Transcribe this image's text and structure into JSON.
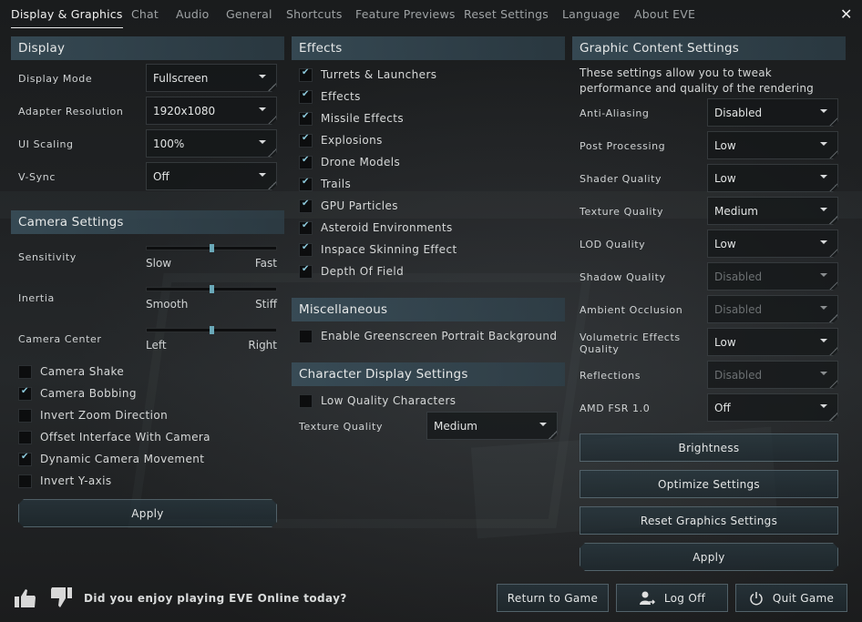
{
  "tabs": [
    {
      "label": "Display & Graphics",
      "active": true
    },
    {
      "label": "Chat"
    },
    {
      "label": "Audio"
    },
    {
      "label": "General"
    },
    {
      "label": "Shortcuts"
    },
    {
      "label": "Feature Previews"
    },
    {
      "label": "Reset Settings"
    },
    {
      "label": "Language"
    },
    {
      "label": "About EVE"
    }
  ],
  "close_icon": "✕",
  "display": {
    "title": "Display",
    "rows": [
      {
        "label": "Display Mode",
        "value": "Fullscreen"
      },
      {
        "label": "Adapter Resolution",
        "value": "1920x1080"
      },
      {
        "label": "UI Scaling",
        "value": "100%"
      },
      {
        "label": "V-Sync",
        "value": "Off"
      }
    ]
  },
  "camera": {
    "title": "Camera Settings",
    "sliders": [
      {
        "label": "Sensitivity",
        "min_label": "Slow",
        "max_label": "Fast",
        "value_pct": 50
      },
      {
        "label": "Inertia",
        "min_label": "Smooth",
        "max_label": "Stiff",
        "value_pct": 50
      },
      {
        "label": "Camera Center",
        "min_label": "Left",
        "max_label": "Right",
        "value_pct": 50
      }
    ],
    "checkboxes": [
      {
        "label": "Camera Shake",
        "checked": false
      },
      {
        "label": "Camera Bobbing",
        "checked": true
      },
      {
        "label": "Invert Zoom Direction",
        "checked": false
      },
      {
        "label": "Offset Interface With Camera",
        "checked": false
      },
      {
        "label": "Dynamic Camera Movement",
        "checked": true
      },
      {
        "label": "Invert Y-axis",
        "checked": false
      }
    ],
    "apply_label": "Apply"
  },
  "effects": {
    "title": "Effects",
    "checkboxes": [
      {
        "label": "Turrets & Launchers",
        "checked": true
      },
      {
        "label": "Effects",
        "checked": true
      },
      {
        "label": "Missile Effects",
        "checked": true
      },
      {
        "label": "Explosions",
        "checked": true
      },
      {
        "label": "Drone Models",
        "checked": true
      },
      {
        "label": "Trails",
        "checked": true
      },
      {
        "label": "GPU Particles",
        "checked": true
      },
      {
        "label": "Asteroid Environments",
        "checked": true
      },
      {
        "label": "Inspace Skinning Effect",
        "checked": true
      },
      {
        "label": "Depth Of Field",
        "checked": true
      }
    ]
  },
  "misc": {
    "title": "Miscellaneous",
    "checkboxes": [
      {
        "label": "Enable Greenscreen Portrait Background",
        "checked": false
      }
    ]
  },
  "character": {
    "title": "Character Display Settings",
    "checkboxes": [
      {
        "label": "Low Quality Characters",
        "checked": false
      }
    ],
    "texture_label": "Texture Quality",
    "texture_value": "Medium"
  },
  "graphics": {
    "title": "Graphic Content Settings",
    "description": "These settings allow you to tweak performance and quality of the rendering",
    "rows": [
      {
        "label": "Anti-Aliasing",
        "value": "Disabled",
        "disabled": false
      },
      {
        "label": "Post Processing",
        "value": "Low",
        "disabled": false
      },
      {
        "label": "Shader Quality",
        "value": "Low",
        "disabled": false
      },
      {
        "label": "Texture Quality",
        "value": "Medium",
        "disabled": false
      },
      {
        "label": "LOD Quality",
        "value": "Low",
        "disabled": false
      },
      {
        "label": "Shadow Quality",
        "value": "Disabled",
        "disabled": true
      },
      {
        "label": "Ambient Occlusion",
        "value": "Disabled",
        "disabled": true
      },
      {
        "label": "Volumetric Effects Quality",
        "value": "Low",
        "disabled": false
      },
      {
        "label": "Reflections",
        "value": "Disabled",
        "disabled": true
      },
      {
        "label": "AMD FSR 1.0",
        "value": "Off",
        "disabled": false
      }
    ],
    "buttons": {
      "brightness": "Brightness",
      "optimize": "Optimize Settings",
      "reset": "Reset Graphics Settings",
      "apply": "Apply"
    }
  },
  "footer": {
    "question": "Did you enjoy playing EVE Online today?",
    "return_label": "Return to Game",
    "logoff_label": "Log Off",
    "quit_label": "Quit Game"
  },
  "colors": {
    "accent": "#6aa8b8",
    "section_header": "#3a505c",
    "check": "#8cc8da"
  }
}
